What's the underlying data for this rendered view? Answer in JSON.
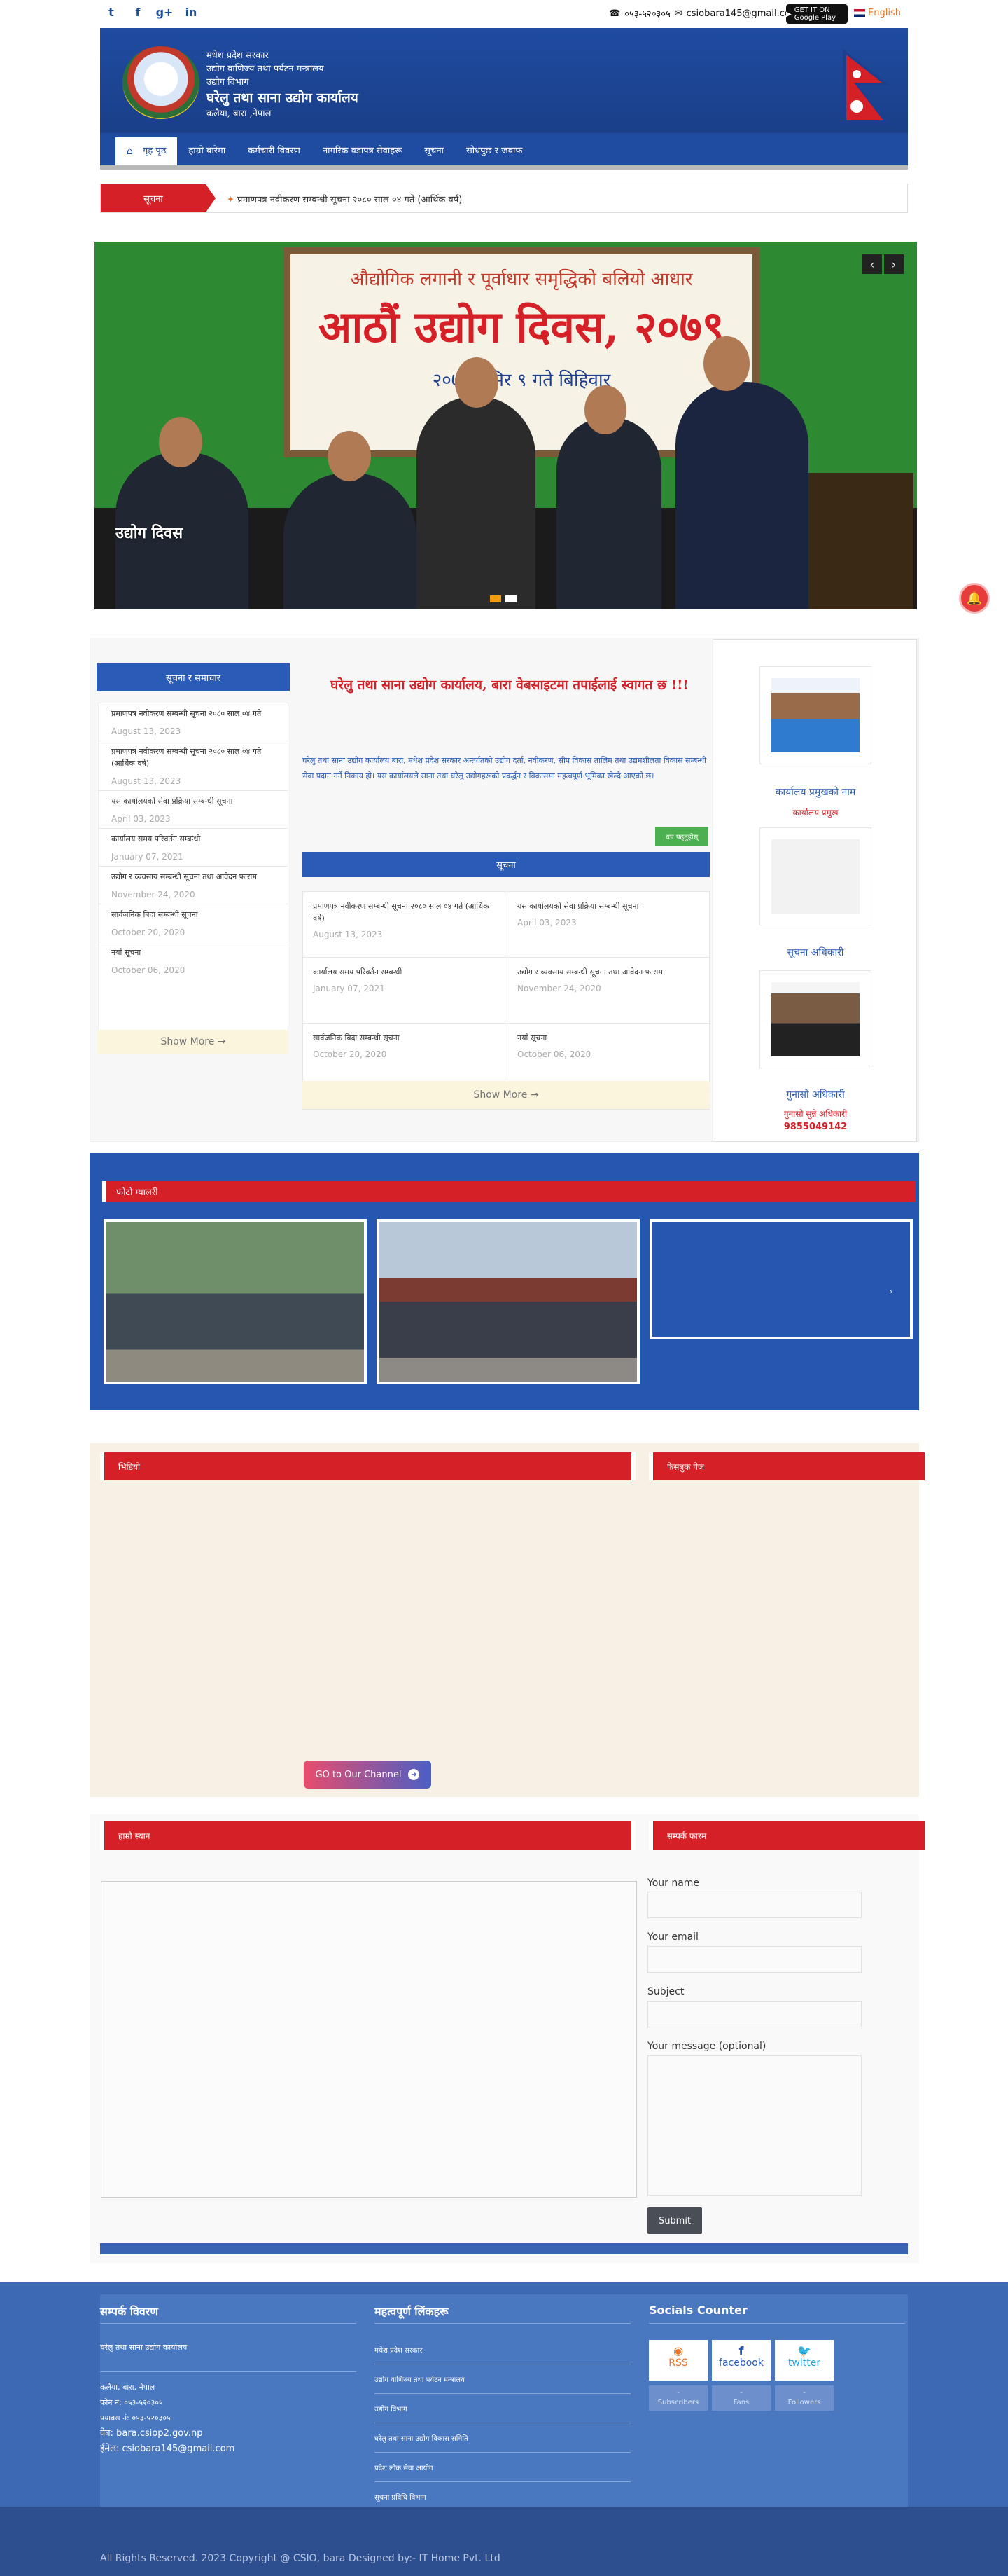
{
  "topbar": {
    "social": [
      "twitter",
      "facebook",
      "google-plus",
      "linkedin"
    ],
    "phone": "०५३-५२०३०५",
    "email": "csiobara145@gmail.com",
    "gplay_label": "GET IT ON Google Play",
    "language": "English"
  },
  "header": {
    "line1": "मधेश प्रदेश सरकार",
    "line2": "उद्योग वाणिज्य तथा पर्यटन मन्त्रालय",
    "line3": "उद्योग विभाग",
    "office": "घरेलु तथा साना उद्योग कार्यालय",
    "location": "कलैया, बारा ,नेपाल"
  },
  "nav": {
    "items": [
      "गृह पृष्ठ",
      "हाम्रो बारेमा",
      "कर्मचारी विवरण",
      "नागरिक वडापत्र सेवाहरू",
      "सूचना",
      "सोधपुछ र जवाफ"
    ]
  },
  "ticker": {
    "label": "सूचना",
    "text": "प्रमाणपत्र नवीकरण सम्बन्धी सूचना २०८० साल ०४ गते (आर्थिक वर्ष)"
  },
  "slider": {
    "banner_top": "औद्योगिक लगानी र पूर्वाधार समृद्धिको बलियो आधार",
    "banner_main": "आठौं उद्योग दिवस, २०७९",
    "banner_date": "२०७९ मंसिर ९ गते बिहिवार",
    "caption": "उद्योग दिवस"
  },
  "sidebar": {
    "heading": "सूचना र समाचार",
    "items": [
      {
        "title": "प्रमाणपत्र नवीकरण सम्बन्धी सूचना २०८० साल ०४ गते",
        "date": "August 13, 2023"
      },
      {
        "title": "प्रमाणपत्र नवीकरण सम्बन्धी सूचना २०८० साल ०४ गते (आर्थिक वर्ष)",
        "date": "August 13, 2023"
      },
      {
        "title": "यस कार्यालयको सेवा प्रक्रिया सम्बन्धी सूचना",
        "date": "April 03, 2023"
      },
      {
        "title": "कार्यालय समय परिवर्तन सम्बन्धी",
        "date": "January 07, 2021"
      },
      {
        "title": "उद्योग र व्यवसाय सम्बन्धी सूचना तथा आवेदन फाराम",
        "date": "November 24, 2020"
      },
      {
        "title": "सार्वजनिक बिदा सम्बन्धी सूचना",
        "date": "October 20, 2020"
      },
      {
        "title": "नयाँ सूचना",
        "date": "October 06, 2020"
      }
    ],
    "show_more": "Show More →"
  },
  "center": {
    "title": "घरेलु तथा साना उद्योग कार्यालय, बारा वेबसाइटमा तपाईलाई स्वागत छ !!!",
    "intro": "घरेलु तथा साना उद्योग कार्यालय बारा, मधेश प्रदेश सरकार अन्तर्गतको उद्योग दर्ता, नवीकरण, सीप विकास तालिम तथा उद्यमशीलता विकास सम्बन्धी सेवा प्रदान गर्ने निकाय हो। यस कार्यालयले साना तथा घरेलु उद्योगहरूको प्रवर्द्धन र विकासमा महत्वपूर्ण भूमिका खेल्दै आएको छ।",
    "read_more": "थप पढ्नुहोस्",
    "notice_heading": "सूचना",
    "notices": [
      {
        "title": "प्रमाणपत्र नवीकरण सम्बन्धी सूचना २०८० साल ०४ गते (आर्थिक वर्ष)",
        "date": "August 13, 2023"
      },
      {
        "title": "यस कार्यालयको सेवा प्रक्रिया सम्बन्धी सूचना",
        "date": "April 03, 2023"
      },
      {
        "title": "कार्यालय समय परिवर्तन सम्बन्धी",
        "date": "January 07, 2021"
      },
      {
        "title": "उद्योग र व्यवसाय सम्बन्धी सूचना तथा आवेदन फाराम",
        "date": "November 24, 2020"
      },
      {
        "title": "सार्वजनिक बिदा सम्बन्धी सूचना",
        "date": "October 20, 2020"
      },
      {
        "title": "नयाँ सूचना",
        "date": "October 06, 2020"
      }
    ],
    "show_more": "Show More →"
  },
  "officials": [
    {
      "name": "कार्यालय प्रमुखको नाम",
      "role": "कार्यालय प्रमुख"
    },
    {
      "name": "सूचना अधिकारी",
      "role": ""
    },
    {
      "name": "गुनासो अधिकारी",
      "role": "गुनासो सुन्ने अधिकारी",
      "phone": "9855049142"
    }
  ],
  "gallery": {
    "heading": "फोटो ग्यालरी"
  },
  "video": {
    "heading": "भिडियो",
    "fb_heading": "फेसबुक पेज",
    "button": "GO to Our Channel"
  },
  "contact": {
    "map_heading": "हाम्रो स्थान",
    "form_heading": "सम्पर्क फारम",
    "name_label": "Your name",
    "email_label": "Your email",
    "subject_label": "Subject",
    "message_label": "Your message (optional)",
    "submit": "Submit"
  },
  "footer": {
    "col1_heading": "सम्पर्क विवरण",
    "col1_office": "घरेलु तथा साना उद्योग कार्यालय",
    "col1_lines": [
      "कलैया, बारा, नेपाल",
      "फोन नं: ०५३-५२०३०५",
      "फ्याक्स नं: ०५३-५२०३०५"
    ],
    "web": "वेब: bara.csiop2.gov.np",
    "email": "ईमेल: csiobara145@gmail.com",
    "col2_heading": "महत्वपूर्ण लिंकहरू",
    "col2_links": [
      "मधेश प्रदेश सरकार",
      "उद्योग वाणिज्य तथा पर्यटन मन्त्रालय",
      "उद्योग विभाग",
      "घरेलु तथा साना उद्योग विकास समिति",
      "प्रदेश लोक सेवा आयोग",
      "सूचना प्रविधि विभाग"
    ],
    "col3_heading": "Socials Counter",
    "socials": [
      {
        "name": "RSS",
        "sub": "Subscribers"
      },
      {
        "name": "facebook",
        "sub": "Fans"
      },
      {
        "name": "twitter",
        "sub": "Followers"
      }
    ],
    "copyright": "All Rights Reserved. 2023 Copyright @ CSIO, bara Designed by:- IT Home Pvt. Ltd"
  }
}
